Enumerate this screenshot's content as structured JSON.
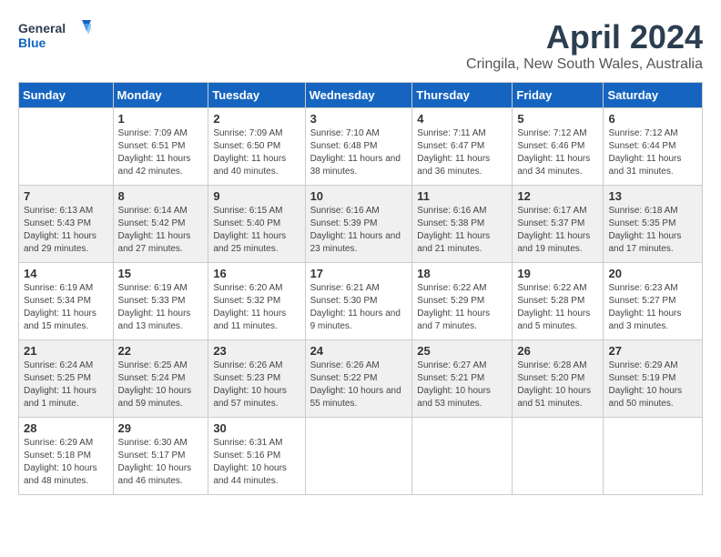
{
  "header": {
    "logo_general": "General",
    "logo_blue": "Blue",
    "month_year": "April 2024",
    "location": "Cringila, New South Wales, Australia"
  },
  "days_of_week": [
    "Sunday",
    "Monday",
    "Tuesday",
    "Wednesday",
    "Thursday",
    "Friday",
    "Saturday"
  ],
  "weeks": [
    [
      {
        "day": "",
        "sunrise": "",
        "sunset": "",
        "daylight": ""
      },
      {
        "day": "1",
        "sunrise": "Sunrise: 7:09 AM",
        "sunset": "Sunset: 6:51 PM",
        "daylight": "Daylight: 11 hours and 42 minutes."
      },
      {
        "day": "2",
        "sunrise": "Sunrise: 7:09 AM",
        "sunset": "Sunset: 6:50 PM",
        "daylight": "Daylight: 11 hours and 40 minutes."
      },
      {
        "day": "3",
        "sunrise": "Sunrise: 7:10 AM",
        "sunset": "Sunset: 6:48 PM",
        "daylight": "Daylight: 11 hours and 38 minutes."
      },
      {
        "day": "4",
        "sunrise": "Sunrise: 7:11 AM",
        "sunset": "Sunset: 6:47 PM",
        "daylight": "Daylight: 11 hours and 36 minutes."
      },
      {
        "day": "5",
        "sunrise": "Sunrise: 7:12 AM",
        "sunset": "Sunset: 6:46 PM",
        "daylight": "Daylight: 11 hours and 34 minutes."
      },
      {
        "day": "6",
        "sunrise": "Sunrise: 7:12 AM",
        "sunset": "Sunset: 6:44 PM",
        "daylight": "Daylight: 11 hours and 31 minutes."
      }
    ],
    [
      {
        "day": "7",
        "sunrise": "Sunrise: 6:13 AM",
        "sunset": "Sunset: 5:43 PM",
        "daylight": "Daylight: 11 hours and 29 minutes."
      },
      {
        "day": "8",
        "sunrise": "Sunrise: 6:14 AM",
        "sunset": "Sunset: 5:42 PM",
        "daylight": "Daylight: 11 hours and 27 minutes."
      },
      {
        "day": "9",
        "sunrise": "Sunrise: 6:15 AM",
        "sunset": "Sunset: 5:40 PM",
        "daylight": "Daylight: 11 hours and 25 minutes."
      },
      {
        "day": "10",
        "sunrise": "Sunrise: 6:16 AM",
        "sunset": "Sunset: 5:39 PM",
        "daylight": "Daylight: 11 hours and 23 minutes."
      },
      {
        "day": "11",
        "sunrise": "Sunrise: 6:16 AM",
        "sunset": "Sunset: 5:38 PM",
        "daylight": "Daylight: 11 hours and 21 minutes."
      },
      {
        "day": "12",
        "sunrise": "Sunrise: 6:17 AM",
        "sunset": "Sunset: 5:37 PM",
        "daylight": "Daylight: 11 hours and 19 minutes."
      },
      {
        "day": "13",
        "sunrise": "Sunrise: 6:18 AM",
        "sunset": "Sunset: 5:35 PM",
        "daylight": "Daylight: 11 hours and 17 minutes."
      }
    ],
    [
      {
        "day": "14",
        "sunrise": "Sunrise: 6:19 AM",
        "sunset": "Sunset: 5:34 PM",
        "daylight": "Daylight: 11 hours and 15 minutes."
      },
      {
        "day": "15",
        "sunrise": "Sunrise: 6:19 AM",
        "sunset": "Sunset: 5:33 PM",
        "daylight": "Daylight: 11 hours and 13 minutes."
      },
      {
        "day": "16",
        "sunrise": "Sunrise: 6:20 AM",
        "sunset": "Sunset: 5:32 PM",
        "daylight": "Daylight: 11 hours and 11 minutes."
      },
      {
        "day": "17",
        "sunrise": "Sunrise: 6:21 AM",
        "sunset": "Sunset: 5:30 PM",
        "daylight": "Daylight: 11 hours and 9 minutes."
      },
      {
        "day": "18",
        "sunrise": "Sunrise: 6:22 AM",
        "sunset": "Sunset: 5:29 PM",
        "daylight": "Daylight: 11 hours and 7 minutes."
      },
      {
        "day": "19",
        "sunrise": "Sunrise: 6:22 AM",
        "sunset": "Sunset: 5:28 PM",
        "daylight": "Daylight: 11 hours and 5 minutes."
      },
      {
        "day": "20",
        "sunrise": "Sunrise: 6:23 AM",
        "sunset": "Sunset: 5:27 PM",
        "daylight": "Daylight: 11 hours and 3 minutes."
      }
    ],
    [
      {
        "day": "21",
        "sunrise": "Sunrise: 6:24 AM",
        "sunset": "Sunset: 5:25 PM",
        "daylight": "Daylight: 11 hours and 1 minute."
      },
      {
        "day": "22",
        "sunrise": "Sunrise: 6:25 AM",
        "sunset": "Sunset: 5:24 PM",
        "daylight": "Daylight: 10 hours and 59 minutes."
      },
      {
        "day": "23",
        "sunrise": "Sunrise: 6:26 AM",
        "sunset": "Sunset: 5:23 PM",
        "daylight": "Daylight: 10 hours and 57 minutes."
      },
      {
        "day": "24",
        "sunrise": "Sunrise: 6:26 AM",
        "sunset": "Sunset: 5:22 PM",
        "daylight": "Daylight: 10 hours and 55 minutes."
      },
      {
        "day": "25",
        "sunrise": "Sunrise: 6:27 AM",
        "sunset": "Sunset: 5:21 PM",
        "daylight": "Daylight: 10 hours and 53 minutes."
      },
      {
        "day": "26",
        "sunrise": "Sunrise: 6:28 AM",
        "sunset": "Sunset: 5:20 PM",
        "daylight": "Daylight: 10 hours and 51 minutes."
      },
      {
        "day": "27",
        "sunrise": "Sunrise: 6:29 AM",
        "sunset": "Sunset: 5:19 PM",
        "daylight": "Daylight: 10 hours and 50 minutes."
      }
    ],
    [
      {
        "day": "28",
        "sunrise": "Sunrise: 6:29 AM",
        "sunset": "Sunset: 5:18 PM",
        "daylight": "Daylight: 10 hours and 48 minutes."
      },
      {
        "day": "29",
        "sunrise": "Sunrise: 6:30 AM",
        "sunset": "Sunset: 5:17 PM",
        "daylight": "Daylight: 10 hours and 46 minutes."
      },
      {
        "day": "30",
        "sunrise": "Sunrise: 6:31 AM",
        "sunset": "Sunset: 5:16 PM",
        "daylight": "Daylight: 10 hours and 44 minutes."
      },
      {
        "day": "",
        "sunrise": "",
        "sunset": "",
        "daylight": ""
      },
      {
        "day": "",
        "sunrise": "",
        "sunset": "",
        "daylight": ""
      },
      {
        "day": "",
        "sunrise": "",
        "sunset": "",
        "daylight": ""
      },
      {
        "day": "",
        "sunrise": "",
        "sunset": "",
        "daylight": ""
      }
    ]
  ]
}
